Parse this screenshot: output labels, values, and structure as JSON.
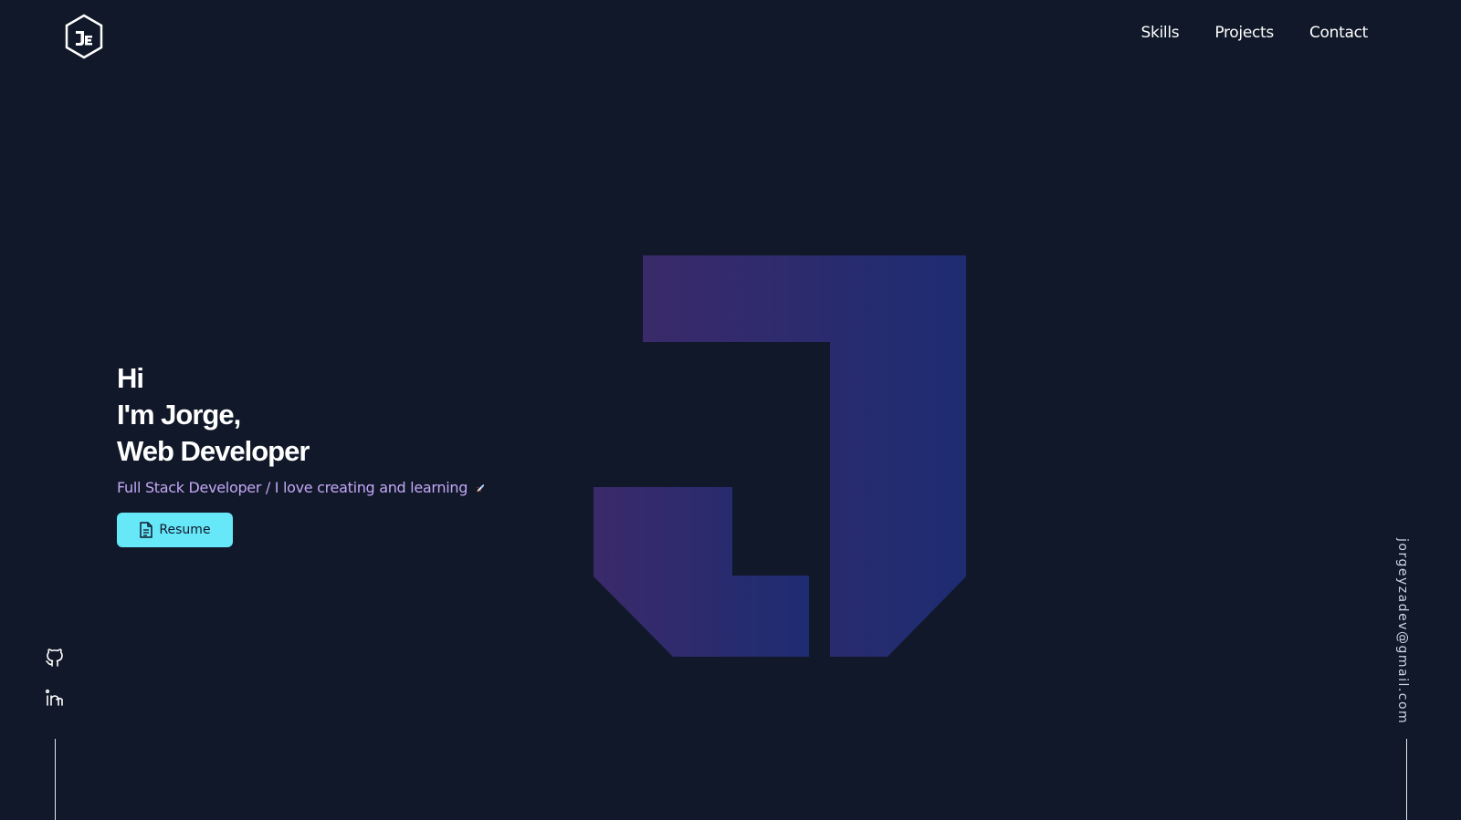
{
  "header": {
    "logo_icon": "je-hexagon-logo-icon",
    "logo_text": "JE",
    "nav": [
      {
        "label": "Skills"
      },
      {
        "label": "Projects"
      },
      {
        "label": "Contact"
      }
    ]
  },
  "hero": {
    "line1": "Hi",
    "line2": "I'm Jorge,",
    "line3": "Web Developer",
    "subtitle": "Full Stack Developer / I love creating and learning",
    "subtitle_icon": "rocket-emoji-icon",
    "resume_label": "Resume",
    "resume_icon": "document-icon",
    "art_icon": "j-monogram-icon"
  },
  "social": {
    "github_icon": "github-icon",
    "linkedin_icon": "linkedin-icon"
  },
  "email": "jorgeyzadev@gmail.com",
  "colors": {
    "background": "#101829",
    "accent": "#67e8f9",
    "subtitle": "#c4a7f5",
    "art_start": "#3b2a6b",
    "art_end": "#1e2c72"
  }
}
